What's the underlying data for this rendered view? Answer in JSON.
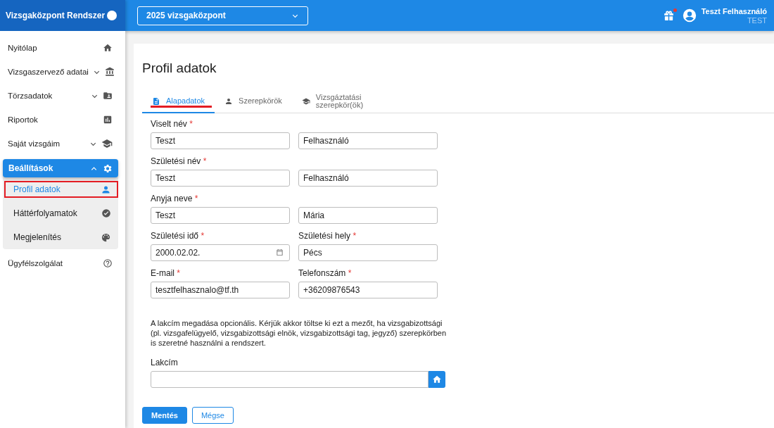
{
  "app_title": "Vizsgaközpont Rendszer",
  "exam_center_select": {
    "value": "2025 vizsgaközpont"
  },
  "notifications": {
    "unread": true
  },
  "user": {
    "name": "Teszt Felhasználó",
    "role": "TEST"
  },
  "sidebar": {
    "items": [
      {
        "label": "Nyitólap",
        "selected": false
      },
      {
        "label": "Vizsgaszervező adatai",
        "selected": false,
        "expanded": false
      },
      {
        "label": "Törzsadatok",
        "selected": false,
        "expanded": false
      },
      {
        "label": "Riportok",
        "selected": false
      },
      {
        "label": "Saját vizsgáim",
        "selected": false,
        "expanded": false
      },
      {
        "label": "Beállítások",
        "selected": true,
        "expanded": true,
        "children": [
          {
            "label": "Profil adatok",
            "selected": true,
            "highlighted": true
          },
          {
            "label": "Háttérfolyamatok",
            "selected": false,
            "highlighted": false
          },
          {
            "label": "Megjelenítés",
            "selected": false,
            "highlighted": false
          }
        ]
      },
      {
        "label": "Ügyfélszolgálat",
        "selected": false
      }
    ]
  },
  "page_title": "Profil adatok",
  "tabs": [
    {
      "label": "Alapadatok",
      "selected": true,
      "highlighted": true
    },
    {
      "label": "Szerepkörök",
      "selected": false,
      "highlighted": false
    },
    {
      "label": "Vizsgáztatási szerepkör(ök)",
      "selected": false,
      "highlighted": false
    }
  ],
  "form": {
    "rows": [
      {
        "fields": [
          {
            "label": "Viselt név",
            "required_mark": "*",
            "value": "Teszt",
            "kind": "text"
          },
          {
            "value": "Felhasználó",
            "kind": "text"
          }
        ]
      },
      {
        "fields": [
          {
            "label": "Születési név",
            "required_mark": "*",
            "value": "Teszt",
            "kind": "text"
          },
          {
            "value": "Felhasználó",
            "kind": "text"
          }
        ]
      },
      {
        "fields": [
          {
            "label": "Anyja neve",
            "required_mark": "*",
            "value": "Teszt",
            "kind": "text"
          },
          {
            "value": "Mária",
            "kind": "text"
          }
        ]
      },
      {
        "fields": [
          {
            "label": "Születési idő",
            "required_mark": "*",
            "value": "2000.02.02.",
            "kind": "date"
          },
          {
            "label": "Születési hely",
            "required_mark": "*",
            "value": "Pécs",
            "kind": "text"
          }
        ]
      },
      {
        "fields": [
          {
            "label": "E-mail",
            "required_mark": "*",
            "value": "tesztfelhasznalo@tf.th",
            "kind": "text"
          },
          {
            "label": "Telefonszám",
            "required_mark": "*",
            "value": "+36209876543",
            "kind": "text"
          }
        ]
      }
    ],
    "note": "A lakcím megadása opcionális. Kérjük akkor töltse ki ezt a mezőt, ha vizsgabizottsági (pl. vizsgafelügyelő, vizsgabizottsági elnök, vizsgabizottsági tag, jegyző) szerepkörben is szeretné használni a rendszert.",
    "address": {
      "label": "Lakcím"
    }
  },
  "buttons": [
    {
      "label": "Mentés",
      "kind": "primary"
    },
    {
      "label": "Mégse",
      "kind": "secondary"
    }
  ]
}
